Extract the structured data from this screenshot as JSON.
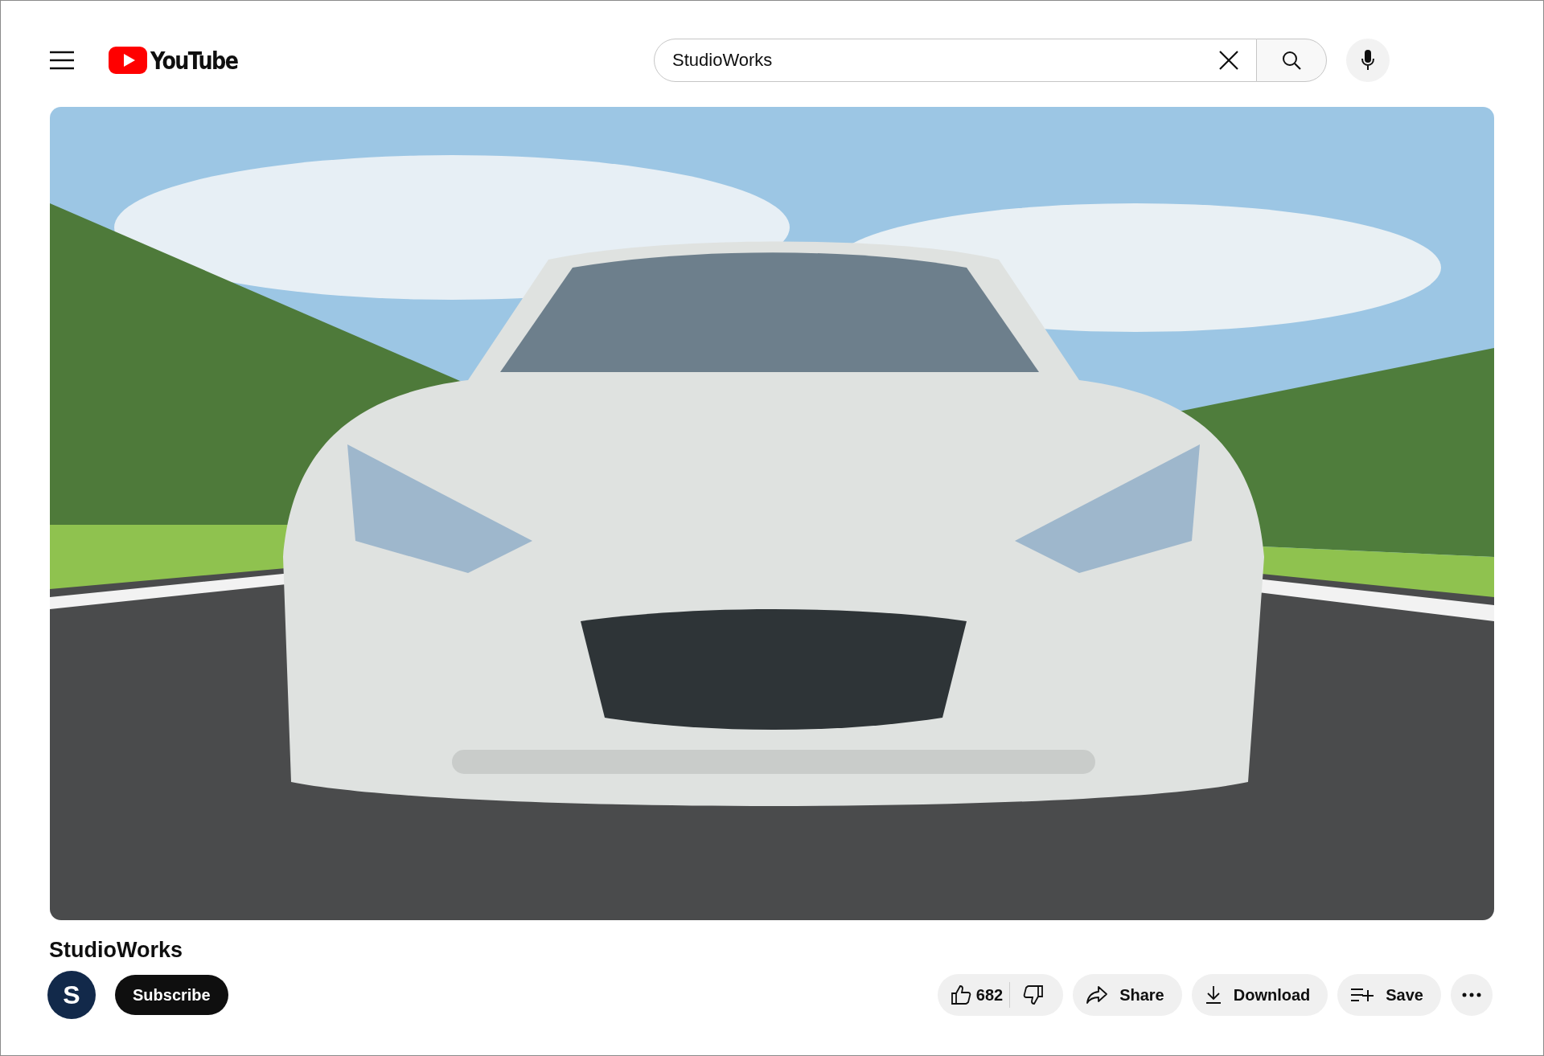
{
  "header": {
    "logo_text": "YouTube",
    "search": {
      "value": "StudioWorks"
    }
  },
  "title": "StudioWorks",
  "channel": {
    "avatar_letter": "S",
    "subscribe": "Subscribe"
  },
  "actions": {
    "likes": "682",
    "buttons": [
      {
        "kind": "share",
        "label": "Share"
      },
      {
        "kind": "download",
        "label": "Download"
      },
      {
        "kind": "save",
        "label": "Save"
      }
    ]
  }
}
